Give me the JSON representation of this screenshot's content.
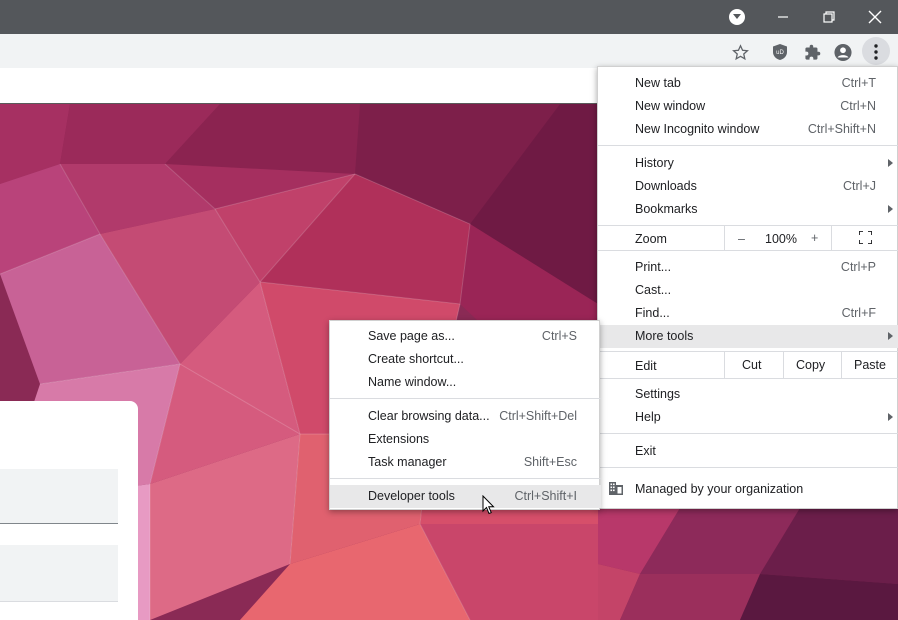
{
  "menu": {
    "items": {
      "new_tab": {
        "label": "New tab",
        "shortcut": "Ctrl+T"
      },
      "new_window": {
        "label": "New window",
        "shortcut": "Ctrl+N"
      },
      "new_incognito": {
        "label": "New Incognito window",
        "shortcut": "Ctrl+Shift+N"
      },
      "history": {
        "label": "History"
      },
      "downloads": {
        "label": "Downloads",
        "shortcut": "Ctrl+J"
      },
      "bookmarks": {
        "label": "Bookmarks"
      },
      "print": {
        "label": "Print...",
        "shortcut": "Ctrl+P"
      },
      "cast": {
        "label": "Cast..."
      },
      "find": {
        "label": "Find...",
        "shortcut": "Ctrl+F"
      },
      "more_tools": {
        "label": "More tools"
      },
      "settings": {
        "label": "Settings"
      },
      "help": {
        "label": "Help"
      },
      "exit": {
        "label": "Exit"
      }
    },
    "zoom": {
      "label": "Zoom",
      "minus": "–",
      "value": "100%",
      "plus": "+"
    },
    "edit": {
      "label": "Edit",
      "cut": "Cut",
      "copy": "Copy",
      "paste": "Paste"
    },
    "managed": "Managed by your organization"
  },
  "submenu": {
    "items": {
      "save_page": {
        "label": "Save page as...",
        "shortcut": "Ctrl+S"
      },
      "create_shortcut": {
        "label": "Create shortcut..."
      },
      "name_window": {
        "label": "Name window..."
      },
      "clear_data": {
        "label": "Clear browsing data...",
        "shortcut": "Ctrl+Shift+Del"
      },
      "extensions": {
        "label": "Extensions"
      },
      "task_manager": {
        "label": "Task manager",
        "shortcut": "Shift+Esc"
      },
      "dev_tools": {
        "label": "Developer tools",
        "shortcut": "Ctrl+Shift+I"
      }
    }
  },
  "toolbar": {
    "icons": [
      "star-icon",
      "ublock-icon",
      "extensions-icon",
      "profile-icon",
      "menu-icon"
    ]
  },
  "colors": {
    "titlebar": "#54575b",
    "toolbar": "#f1f3f4",
    "highlight": "#e8e8e9"
  }
}
